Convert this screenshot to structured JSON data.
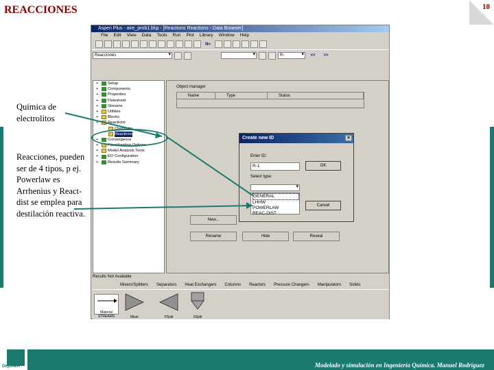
{
  "slide": {
    "title": "REACCIONES",
    "page_number": "18",
    "footer": "Modelado y simulación en Ingeniería Química. Manuel Rodríguez",
    "logo_text": "DIQUIMA"
  },
  "annotations": {
    "first": "Química de electrolitos",
    "second": "Reacciones, pueden ser de 4 tipos, p ej. Powerlaw es Arrhenius y React-dist se emplea para destilación reactiva."
  },
  "app": {
    "title": "Aspen Plus - aire_prob1.bkp - [Reactions Reactions - Data Browser]",
    "menu": [
      "File",
      "Edit",
      "View",
      "Data",
      "Tools",
      "Run",
      "Plot",
      "Library",
      "Window",
      "Help"
    ],
    "toolbar_n_label": "N>",
    "combo_value": "Reacciones",
    "combo2_value": "R-",
    "tree": [
      {
        "label": "Setup",
        "icon": "check"
      },
      {
        "label": "Components",
        "icon": "check"
      },
      {
        "label": "Properties",
        "icon": "check"
      },
      {
        "label": "Flowsheet",
        "icon": "check"
      },
      {
        "label": "Streams",
        "icon": "check"
      },
      {
        "label": "Utilities",
        "icon": "folder"
      },
      {
        "label": "Blocks",
        "icon": "folder"
      },
      {
        "label": "Reactions",
        "icon": "folder"
      },
      {
        "label": "Chemistry",
        "icon": "folder"
      },
      {
        "label": "Reactions",
        "icon": "folder"
      },
      {
        "label": "Convergence",
        "icon": "check"
      },
      {
        "label": "Flowsheeting Options",
        "icon": "folder"
      },
      {
        "label": "Model Analysis Tools",
        "icon": "folder"
      },
      {
        "label": "EO Configuration",
        "icon": "check"
      },
      {
        "label": "Results Summary",
        "icon": "check"
      }
    ],
    "object_manager": {
      "label": "Object manager",
      "columns": [
        "Name",
        "Type",
        "Status"
      ]
    },
    "buttons": {
      "new": "New...",
      "rename": "Rename",
      "hide": "Hide",
      "reveal": "Reveal"
    },
    "status_text": "Results Not Available",
    "palette_tabs": [
      "Mixers/Splitters",
      "Separators",
      "Heat Exchangers",
      "Columns",
      "Reactors",
      "Pressure Changers",
      "Manipulators",
      "Solids"
    ],
    "palette_items": [
      "Material STREAMS",
      "Mixer",
      "FSplit",
      "SSplit"
    ]
  },
  "dialog": {
    "title": "Create new ID",
    "enter_id_label": "Enter ID:",
    "id_value": "R-1",
    "select_type_label": "Select type:",
    "options": [
      "GENERAL",
      "LHHW",
      "POWERLAW",
      "REAC-DIST"
    ],
    "ok_label": "OK",
    "cancel_label": "Cancel"
  },
  "colors": {
    "accent": "#1a7a6e",
    "title_red": "#8b0000"
  }
}
